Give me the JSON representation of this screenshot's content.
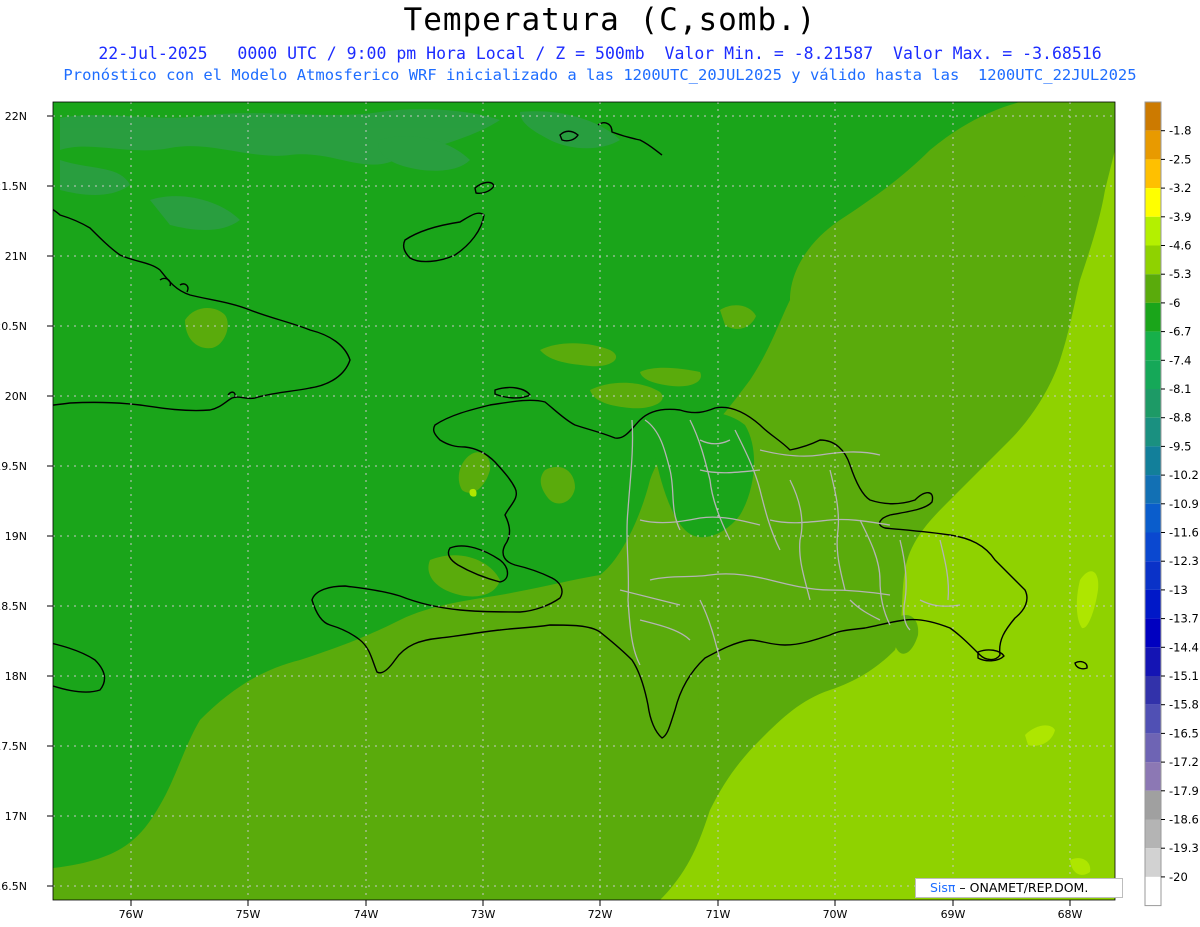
{
  "header": {
    "title": "Temperatura (C,somb.)",
    "subtitle_line1": "22-Jul-2025   0000 UTC / 9:00 pm Hora Local / Z = 500mb  Valor Min. = -8.21587  Valor Max. = -3.68516",
    "subtitle_line2": "Pronóstico con el Modelo Atmosferico WRF inicializado a las 1200UTC_20JUL2025 y válido hasta las  1200UTC_22JUL2025"
  },
  "map": {
    "lat_labels": [
      "22N",
      "21.5N",
      "21N",
      "20.5N",
      "20N",
      "19.5N",
      "19N",
      "18.5N",
      "18N",
      "17.5N",
      "17N",
      "16.5N"
    ],
    "lon_labels": [
      "76W",
      "75W",
      "74W",
      "73W",
      "72W",
      "71W",
      "70W",
      "69W",
      "68W"
    ],
    "fill_colors": {
      "dark_green": "#1aa51a",
      "teal_green": "#2e9c4c",
      "mid_green": "#5aab0c",
      "light_green": "#8fd200",
      "lime": "#aee600"
    },
    "coastline_color": "#000000",
    "province_border_color": "#b4b4b4"
  },
  "colorbar": {
    "labels": [
      "-1.8",
      "-2.5",
      "-3.2",
      "-3.9",
      "-4.6",
      "-5.3",
      "-6",
      "-6.7",
      "-7.4",
      "-8.1",
      "-8.8",
      "-9.5",
      "-10.2",
      "-10.9",
      "-11.6",
      "-12.3",
      "-13",
      "-13.7",
      "-14.4",
      "-15.1",
      "-15.8",
      "-16.5",
      "-17.2",
      "-17.9",
      "-18.6",
      "-19.3",
      "-20"
    ],
    "colors": [
      "#cc7a00",
      "#e89a00",
      "#ffc000",
      "#ffff00",
      "#b4f000",
      "#8fd200",
      "#5aab0c",
      "#1aa51a",
      "#17b04a",
      "#15a858",
      "#1d9a66",
      "#1a9080",
      "#127f9a",
      "#1270b4",
      "#0a5dcc",
      "#0a48d0",
      "#0a32c8",
      "#0018c8",
      "#0000c0",
      "#1414b4",
      "#3232aa",
      "#5050b4",
      "#6e64b4",
      "#8c78b4",
      "#a0a0a0",
      "#b4b4b4",
      "#d2d2d2",
      "#ffffff"
    ]
  },
  "credit": {
    "sis": "Sisπ",
    "text": " – ONAMET/REP.DOM."
  }
}
